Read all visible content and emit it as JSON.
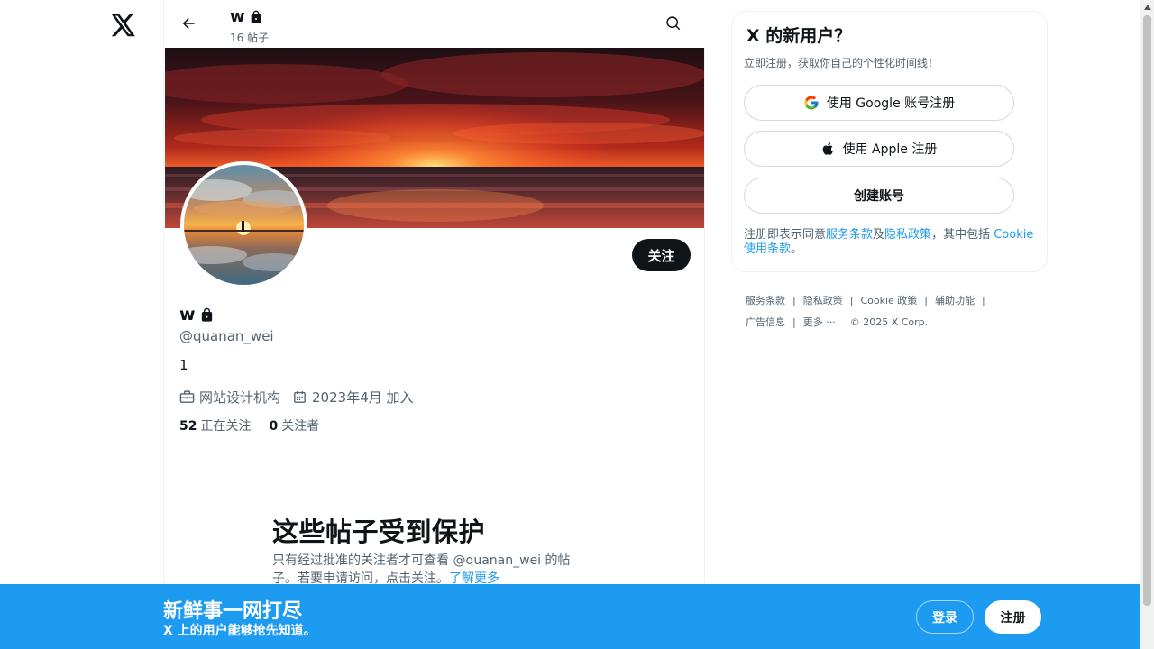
{
  "header": {
    "name": "w",
    "post_count": "16 帖子"
  },
  "profile": {
    "name": "w",
    "handle": "@quanan_wei",
    "bio": "1",
    "category": "网站设计机构",
    "joined": "2023年4月 加入",
    "following_count": "52",
    "following_label": "正在关注",
    "followers_count": "0",
    "followers_label": "关注者",
    "follow_label": "关注"
  },
  "protected": {
    "title": "这些帖子受到保护",
    "text": "只有经过批准的关注者才可查看 @quanan_wei 的帖子。若要申请访问，点击关注。",
    "learn_more": "了解更多"
  },
  "signup_card": {
    "title": "X 的新用户？",
    "subtitle": "立即注册，获取你自己的个性化时间线！",
    "google_label": "使用 Google 账号注册",
    "apple_label": "使用 Apple 注册",
    "create_label": "创建账号",
    "terms_prefix": "注册即表示同意",
    "terms_link": "服务条款",
    "and": "及",
    "privacy_link": "隐私政策",
    "including": "，其中包括 ",
    "cookie_link": "Cookie 使用条款",
    "period": "。"
  },
  "footer": {
    "tos": "服务条款",
    "privacy": "隐私政策",
    "cookie": "Cookie 政策",
    "accessibility": "辅助功能",
    "ads": "广告信息",
    "more": "更多 ···",
    "copyright": "© 2025 X Corp."
  },
  "bottom_bar": {
    "title": "新鲜事一网打尽",
    "subtitle": "X 上的用户能够抢先知道。",
    "login": "登录",
    "signup": "注册"
  },
  "colors": {
    "accent": "#1d9bf0",
    "text": "#0f1419",
    "muted": "#536471",
    "follow_bg": "#0f1419"
  },
  "icons": [
    "x-logo-icon",
    "back-arrow-icon",
    "lock-icon",
    "search-icon",
    "briefcase-icon",
    "calendar-icon",
    "google-icon",
    "apple-icon"
  ]
}
